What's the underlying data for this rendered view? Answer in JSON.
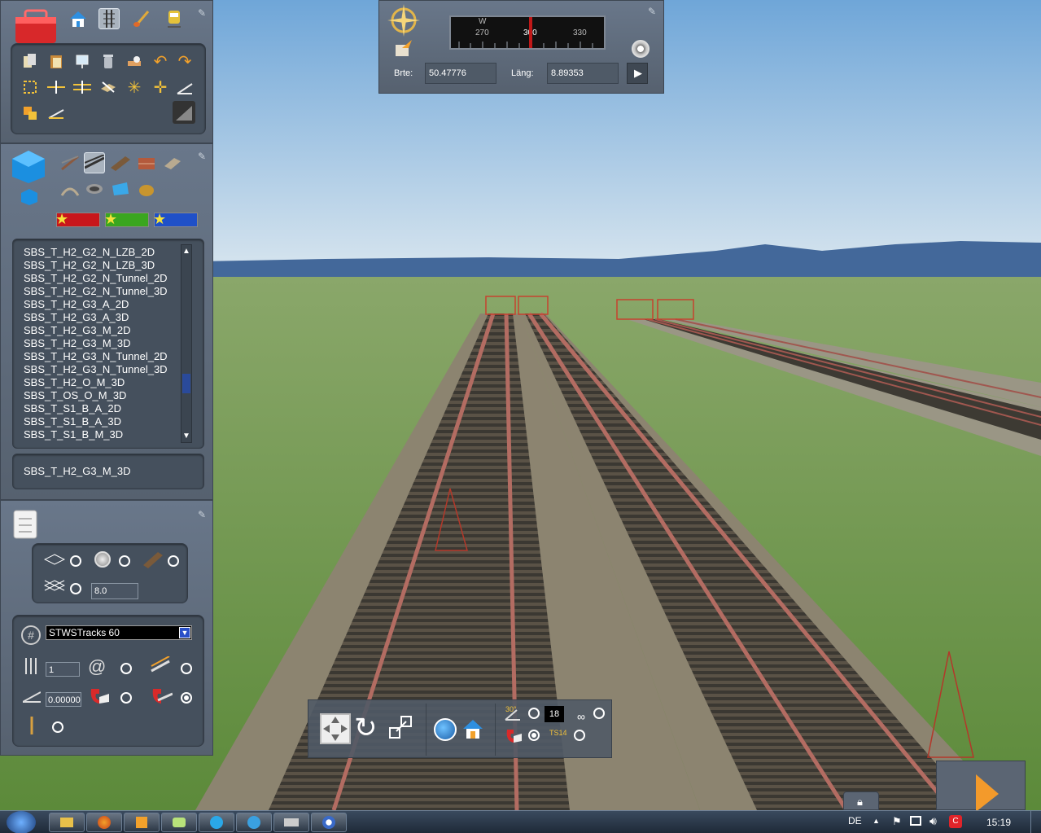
{
  "compass": {
    "dial_letter": "W",
    "ticks": [
      "270",
      "300",
      "330"
    ],
    "lat_label": "Brte:",
    "lat_value": "50.47776",
    "lon_label": "Läng:",
    "lon_value": "8.89353"
  },
  "asset_list": {
    "items": [
      "SBS_T_H2_G2_N_LZB_2D",
      "SBS_T_H2_G2_N_LZB_3D",
      "SBS_T_H2_G2_N_Tunnel_2D",
      "SBS_T_H2_G2_N_Tunnel_3D",
      "SBS_T_H2_G3_A_2D",
      "SBS_T_H2_G3_A_3D",
      "SBS_T_H2_G3_M_2D",
      "SBS_T_H2_G3_M_3D",
      "SBS_T_H2_G3_N_Tunnel_2D",
      "SBS_T_H2_G3_N_Tunnel_3D",
      "SBS_T_H2_O_M_3D",
      "SBS_T_OS_O_M_3D",
      "SBS_T_S1_B_A_2D",
      "SBS_T_S1_B_A_3D",
      "SBS_T_S1_B_M_3D"
    ],
    "selected": "SBS_T_H2_G3_M_3D"
  },
  "properties": {
    "height_value": "8.0"
  },
  "track_tools": {
    "track_rule": "STWSTracks 60",
    "count_value": "1",
    "gradient_value": "0.00000"
  },
  "bottom_bar": {
    "angle_label": "30°",
    "counter_value": "18",
    "ts_label": "TS14"
  },
  "taskbar": {
    "language": "DE",
    "clock": "15:19"
  },
  "colors": {
    "panel": "#5f6b7a",
    "sky_top": "#7fb0dc",
    "grass": "#6a9343",
    "rail": "#a0574f",
    "accent_orange": "#f39a2b"
  }
}
